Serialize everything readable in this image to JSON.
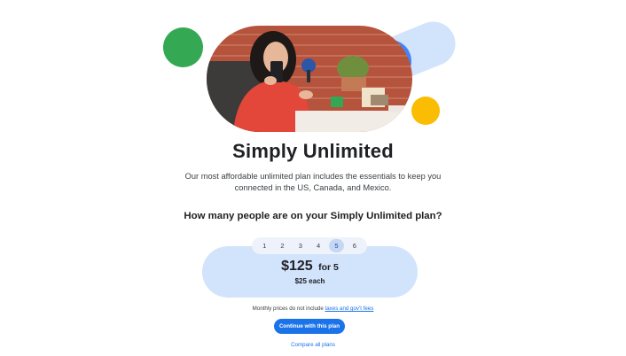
{
  "plan": {
    "title": "Simply Unlimited",
    "description": "Our most affordable unlimited plan includes the essentials to keep you connected in the US, Canada, and Mexico.",
    "question": "How many people are on your Simply Unlimited plan?"
  },
  "selector": {
    "options": [
      "1",
      "2",
      "3",
      "4",
      "5",
      "6"
    ],
    "selected": "5"
  },
  "pricing": {
    "total": "$125",
    "for_label": "for 5",
    "each": "$25 each"
  },
  "footnote": {
    "text": "Monthly prices do not include ",
    "link": "taxes and gov't fees"
  },
  "actions": {
    "continue": "Continue with this plan",
    "compare": "Compare all plans"
  },
  "colors": {
    "accent": "#1a73e8",
    "green": "#34a853",
    "yellow": "#fbbc04",
    "blue": "#4285f4",
    "card": "#d2e3fc"
  }
}
